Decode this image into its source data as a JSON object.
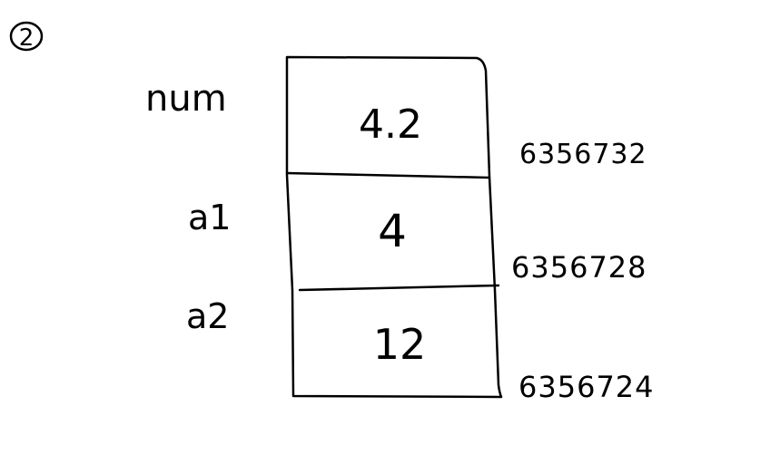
{
  "figure": {
    "number_mark": "2"
  },
  "memory_diagram": {
    "cells": [
      {
        "variable": "num",
        "value": "4.2"
      },
      {
        "variable": "a1",
        "value": "4"
      },
      {
        "variable": "a2",
        "value": "12"
      }
    ],
    "addresses": [
      "6356732",
      "6356728",
      "6356724"
    ]
  }
}
